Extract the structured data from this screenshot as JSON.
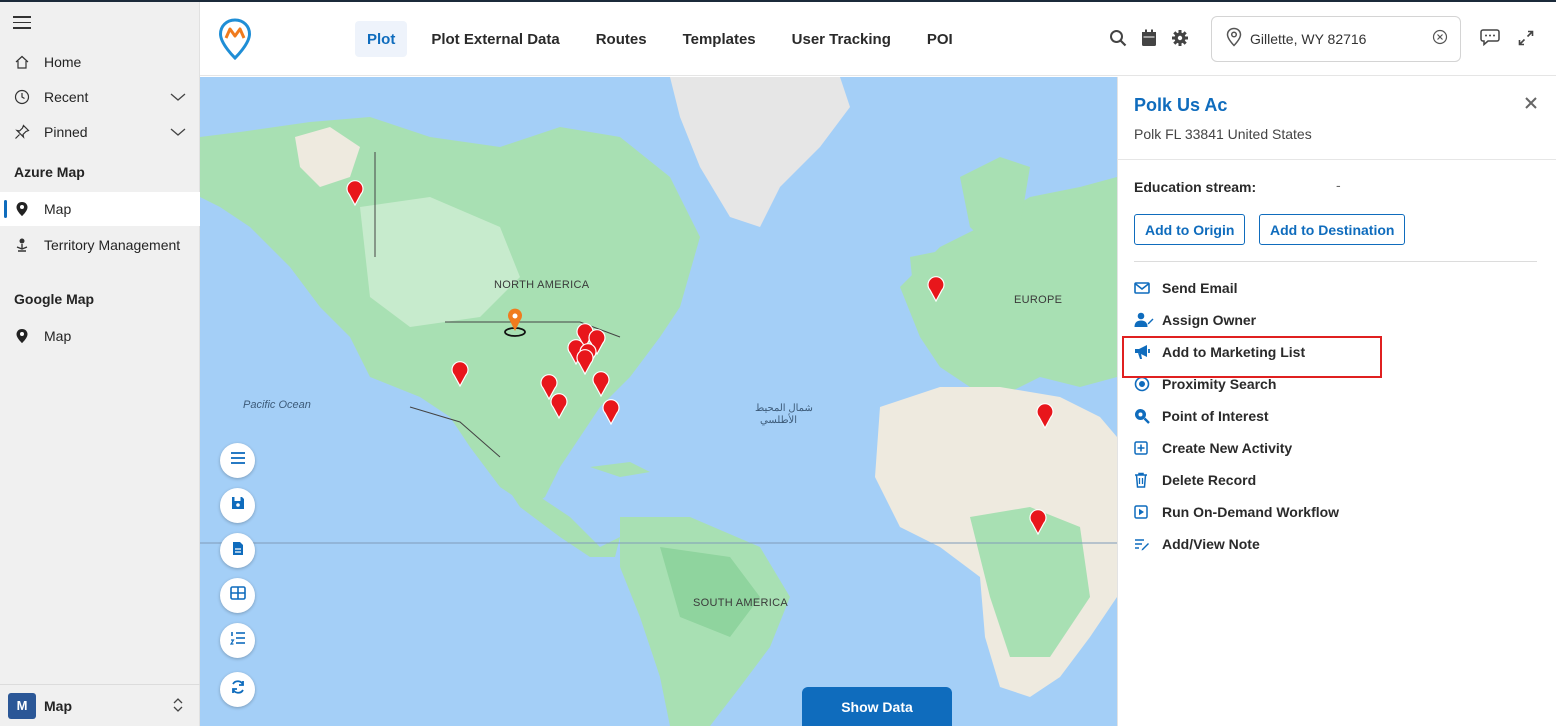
{
  "sidebar": {
    "items_top": [
      {
        "label": "Home",
        "icon": "home-icon"
      },
      {
        "label": "Recent",
        "icon": "clock-icon"
      },
      {
        "label": "Pinned",
        "icon": "pin-icon"
      }
    ],
    "sections": [
      {
        "title": "Azure Map",
        "items": [
          {
            "label": "Map",
            "icon": "map-marker-icon",
            "active": true
          },
          {
            "label": "Territory Management",
            "icon": "territory-icon"
          }
        ]
      },
      {
        "title": "Google Map",
        "items": [
          {
            "label": "Map",
            "icon": "map-marker-icon"
          }
        ]
      }
    ],
    "footer": {
      "badge": "M",
      "label": "Map"
    }
  },
  "header": {
    "tabs": [
      "Plot",
      "Plot External Data",
      "Routes",
      "Templates",
      "User Tracking",
      "POI"
    ],
    "active_tab": "Plot",
    "location_value": "Gillette, WY 82716"
  },
  "map": {
    "labels": {
      "north_america": "NORTH AMERICA",
      "europe": "EUROPE",
      "south_america": "SOUTH AMERICA",
      "pacific": "Pacific Ocean",
      "atlantic_1": "شمال المحيط",
      "atlantic_2": "الأطلسي"
    },
    "show_data_label": "Show Data"
  },
  "panel": {
    "title": "Polk Us Ac",
    "subtitle": "Polk FL 33841 United States",
    "field_label": "Education stream:",
    "field_value": "-",
    "add_origin": "Add to Origin",
    "add_destination": "Add to Destination",
    "actions": [
      {
        "label": "Send Email",
        "icon": "email-icon"
      },
      {
        "label": "Assign Owner",
        "icon": "assign-owner-icon"
      },
      {
        "label": "Add to Marketing List",
        "icon": "megaphone-icon"
      },
      {
        "label": "Proximity Search",
        "icon": "proximity-icon"
      },
      {
        "label": "Point of Interest",
        "icon": "poi-search-icon"
      },
      {
        "label": "Create New Activity",
        "icon": "add-activity-icon"
      },
      {
        "label": "Delete Record",
        "icon": "trash-icon"
      },
      {
        "label": "Run On-Demand Workflow",
        "icon": "play-icon"
      },
      {
        "label": "Add/View Note",
        "icon": "note-icon"
      }
    ]
  },
  "colors": {
    "accent": "#0f6cbd",
    "pin": "#e8161b",
    "current_location_pin": "#f07b1e",
    "highlight": "#e02020",
    "ocean": "#a4cff7",
    "land": "#a8e0b3"
  }
}
